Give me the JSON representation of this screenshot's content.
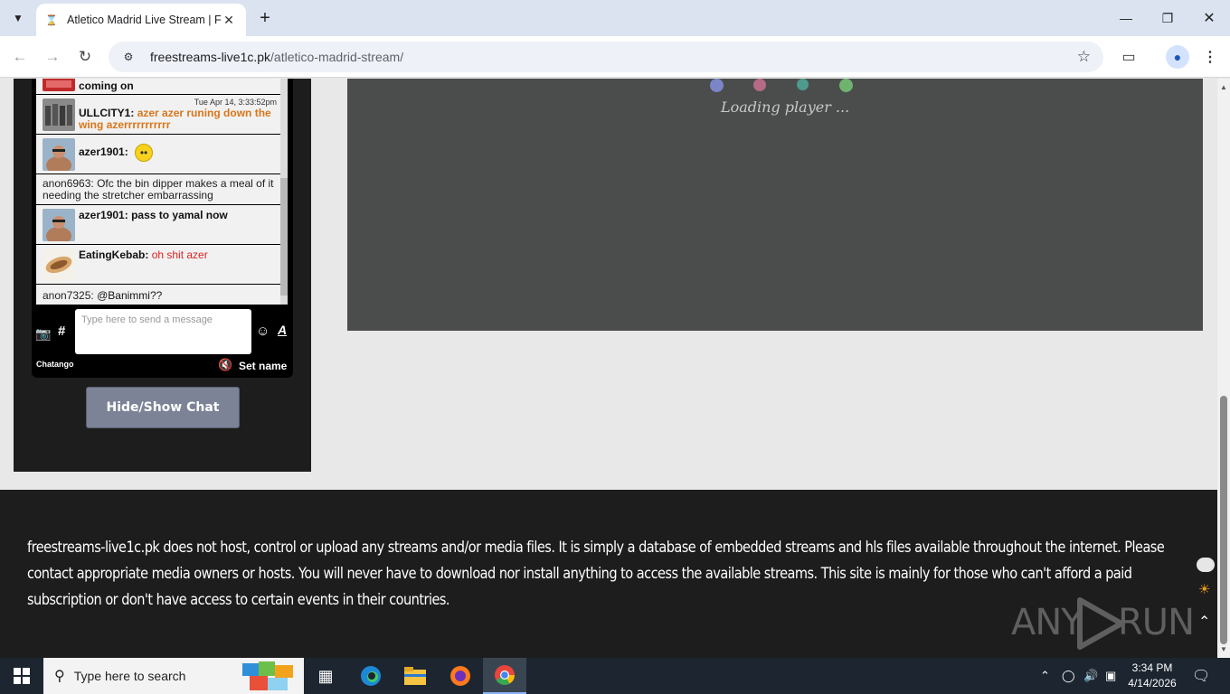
{
  "browser": {
    "tab_title": "Atletico Madrid Live Stream | FS",
    "url_host": "freestreams-live1c.pk",
    "url_path": "/atletico-madrid-stream/"
  },
  "chat": {
    "messages": [
      {
        "user": "",
        "text": "coming on",
        "time": ""
      },
      {
        "user": "ULLCITY1:",
        "text": "azer azer runing down the wing azerrrrrrrrrrr",
        "time": "Tue Apr 14, 3:33:52pm"
      },
      {
        "user": "azer1901:",
        "text": "",
        "time": ""
      },
      {
        "user": "anon6963:",
        "text": "Ofc the bin dipper makes a meal of it needing the stretcher embarrassing",
        "time": ""
      },
      {
        "user": "azer1901:",
        "text": "pass to yamal now",
        "time": ""
      },
      {
        "user": "EatingKebab:",
        "text": "oh shit azer",
        "time": ""
      },
      {
        "user": "anon7325:",
        "mention": "@Banimmi",
        "text": "??",
        "time": ""
      }
    ],
    "input_placeholder": "Type here to send a message",
    "hash_label": "#",
    "font_label": "A",
    "brand": "Chatango",
    "set_name_label": "Set name"
  },
  "hide_show_button": "Hide/Show Chat",
  "player": {
    "loading_text": "Loading player ...",
    "dot_colors": [
      "#7b86c9",
      "#b56a86",
      "#4f9a8c",
      "#6fb36f"
    ]
  },
  "footer": {
    "disclaimer": "freestreams-live1c.pk does not host, control or upload any streams and/or media files. It is simply a database of embedded streams and hls files available throughout the internet. Please contact appropriate media owners or hosts. You will never have to download nor install anything to access the available streams. This site is mainly for those who can't afford a paid subscription or don't have access to certain events in their countries.",
    "watermark_left": "ANY",
    "watermark_right": "RUN"
  },
  "taskbar": {
    "search_placeholder": "Type here to search",
    "time": "3:34 PM",
    "date": "4/14/2026"
  },
  "colors": {
    "player_bg": "#4b4d4d",
    "footer_bg": "#1d1d1d",
    "chat_orange": "#d9761a",
    "chat_red": "#e02020",
    "button_bg": "#7c8397"
  }
}
